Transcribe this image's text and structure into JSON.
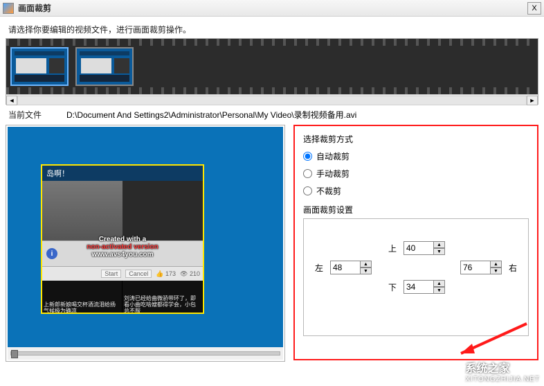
{
  "window": {
    "title": "画面裁剪",
    "close_glyph": "X"
  },
  "instruction": "请选择你要编辑的视频文件，进行画面裁剪操作。",
  "scroll": {
    "left_glyph": "◄",
    "right_glyph": "►"
  },
  "current_file": {
    "label": "当前文件",
    "path": "D:\\Document And Settings2\\Administrator\\Personal\\My Video\\录制视频备用.avi"
  },
  "preview": {
    "head_text": "岛啊！",
    "notice_line1": "Created with a",
    "notice_line2_red": "non-activated version",
    "notice_line3": "www.avs4you.com",
    "btn_start": "Start",
    "btn_cancel": "Cancel",
    "tool_likes": "173",
    "tool_views": "210",
    "card1_text": "上新郎新娘喝交杯酒流泪给扬气候极为确凉",
    "card2_text": "刘涛已经给曲微骄带环了，即看小曲吃啥嫂都得学会，小包总不服"
  },
  "options": {
    "title": "选择裁剪方式",
    "mode_auto": "自动裁剪",
    "mode_manual": "手动裁剪",
    "mode_none": "不裁剪",
    "selected": "auto",
    "group_title": "画面裁剪设置",
    "labels": {
      "top": "上",
      "left": "左",
      "right": "右",
      "bottom": "下"
    },
    "values": {
      "top": "40",
      "left": "48",
      "right": "76",
      "bottom": "34"
    },
    "spin_up": "▲",
    "spin_down": "▼"
  },
  "watermark": {
    "zh": "系统之家",
    "en": "XITONGZHIJIA.NET"
  }
}
